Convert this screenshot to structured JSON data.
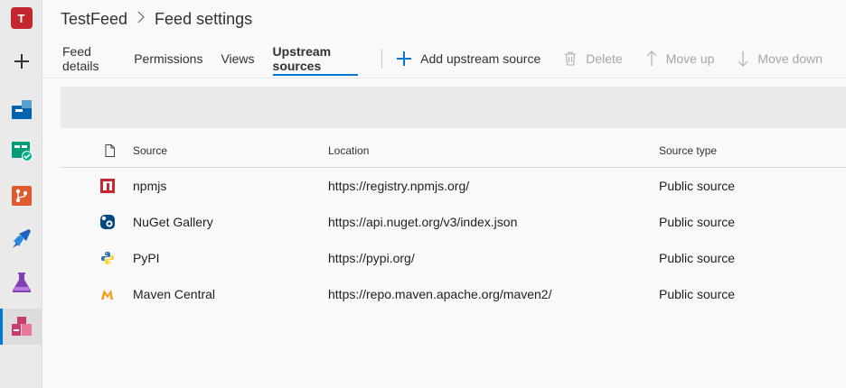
{
  "org": {
    "initial": "T"
  },
  "breadcrumb": {
    "project": "TestFeed",
    "page": "Feed settings"
  },
  "tabs": [
    {
      "label": "Feed details"
    },
    {
      "label": "Permissions"
    },
    {
      "label": "Views"
    },
    {
      "label": "Upstream sources",
      "selected": true
    }
  ],
  "commands": {
    "add": "Add upstream source",
    "delete": "Delete",
    "move_up": "Move up",
    "move_down": "Move down"
  },
  "table": {
    "headers": {
      "source": "Source",
      "location": "Location",
      "type": "Source type"
    },
    "rows": [
      {
        "icon": "npm-icon",
        "source": "npmjs",
        "location": "https://registry.npmjs.org/",
        "type": "Public source"
      },
      {
        "icon": "nuget-icon",
        "source": "NuGet Gallery",
        "location": "https://api.nuget.org/v3/index.json",
        "type": "Public source"
      },
      {
        "icon": "python-icon",
        "source": "PyPI",
        "location": "https://pypi.org/",
        "type": "Public source"
      },
      {
        "icon": "maven-icon",
        "source": "Maven Central",
        "location": "https://repo.maven.apache.org/maven2/",
        "type": "Public source"
      }
    ]
  },
  "colors": {
    "accent": "#0078d4",
    "org_badge": "#c4262d"
  }
}
